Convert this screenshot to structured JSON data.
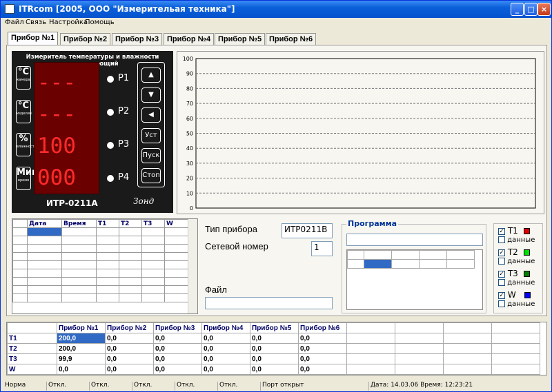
{
  "window": {
    "title": "ITRcom [2005, ООО \"Измерительая техника\"]",
    "min": "_",
    "max": "□",
    "close": "×"
  },
  "menu": [
    "Файл",
    "Связь",
    "Настройка",
    "Помощь"
  ],
  "tabs": [
    "Прибор №1",
    "Прибор №2",
    "Прибор №3",
    "Прибор №4",
    "Прибор №5",
    "Прибор №6"
  ],
  "device": {
    "header": "Измеритель температуры и влажности регулирующий",
    "units": [
      {
        "main": "°C",
        "sub": "камера"
      },
      {
        "main": "°C",
        "sub": "изделие"
      },
      {
        "main": "%",
        "sub": "влажность"
      },
      {
        "main": "Мин",
        "sub": "время"
      }
    ],
    "readings": [
      "---",
      "---",
      "100",
      "000"
    ],
    "leds": [
      "P1",
      "P2",
      "P3",
      "P4"
    ],
    "keys": [
      "▲",
      "▼",
      "◀",
      "Уст",
      "Пуск",
      "Стоп"
    ],
    "model": "ИТР-0211А",
    "logo": "Зонд"
  },
  "chart_data": {
    "type": "line",
    "x": [],
    "series": [],
    "title": "",
    "xlabel": "",
    "ylabel": "",
    "ylim": [
      0,
      100
    ],
    "yticks": [
      0,
      10,
      20,
      30,
      40,
      50,
      60,
      70,
      80,
      90,
      100
    ],
    "grid": true
  },
  "log_table": {
    "columns": [
      "Дата",
      "Время",
      "T1",
      "T2",
      "T3",
      "W"
    ]
  },
  "info": {
    "device_type_label": "Тип прибора",
    "device_type": "ИТР0211В",
    "net_label": "Сетевой номер",
    "net_number": "1",
    "file_label": "Файл",
    "file_value": ""
  },
  "program": {
    "title": "Программа",
    "value": ""
  },
  "channels": [
    {
      "name": "T1",
      "data_label": "данные",
      "checked": true,
      "color": "#e00000"
    },
    {
      "name": "T2",
      "data_label": "данные",
      "checked": true,
      "color": "#00e000"
    },
    {
      "name": "T3",
      "data_label": "данные",
      "checked": true,
      "color": "#008000"
    },
    {
      "name": "W",
      "data_label": "данные",
      "checked": true,
      "color": "#0000ff"
    }
  ],
  "summary": {
    "columns": [
      "Прибор №1",
      "Прибор №2",
      "Прибор №3",
      "Прибор №4",
      "Прибор №5",
      "Прибор №6"
    ],
    "rows": [
      {
        "name": "T1",
        "values": [
          "200,0",
          "0,0",
          "0,0",
          "0,0",
          "0,0",
          "0,0"
        ]
      },
      {
        "name": "T2",
        "values": [
          "200,0",
          "0,0",
          "0,0",
          "0,0",
          "0,0",
          "0,0"
        ]
      },
      {
        "name": "T3",
        "values": [
          "99,9",
          "0,0",
          "0,0",
          "0,0",
          "0,0",
          "0,0"
        ]
      },
      {
        "name": "W",
        "values": [
          "0,0",
          "0,0",
          "0,0",
          "0,0",
          "0,0",
          "0,0"
        ]
      }
    ]
  },
  "status": [
    "Норма",
    "Откл.",
    "Откл.",
    "Откл.",
    "Откл.",
    "Откл.",
    "Порт открыт",
    "Дата: 14.03.06 Время: 12:23:21"
  ]
}
